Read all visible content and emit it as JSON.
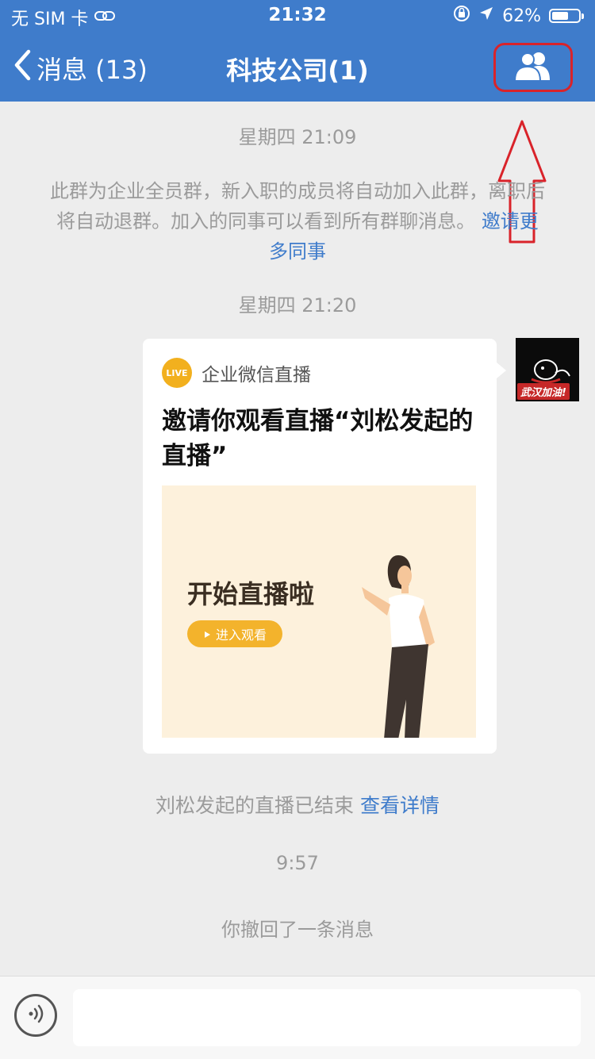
{
  "status": {
    "carrier": "无 SIM 卡",
    "time": "21:32",
    "battery": "62%",
    "battery_level": 0.62
  },
  "nav": {
    "back_label": "消息 (13)",
    "title": "科技公司(1)"
  },
  "messages": {
    "ts1": "星期四 21:09",
    "system_notice": "此群为企业全员群，新入职的成员将自动加入此群，离职后将自动退群。加入的同事可以看到所有群聊消息。",
    "invite_link": "邀请更多同事",
    "ts2": "星期四 21:20",
    "avatar_tag": "武汉加油!",
    "card": {
      "source": "企业微信直播",
      "badge": "LIVE",
      "title": "邀请你观看直播“刘松发起的直播”",
      "banner_heading": "开始直播啦",
      "banner_button": "进入观看"
    },
    "ended_text": "刘松发起的直播已结束",
    "details_link": "查看详情",
    "ts3": "9:57",
    "recall_text": "你撤回了一条消息"
  },
  "colors": {
    "header": "#3f7ccb",
    "annotation": "#d9232a",
    "link": "#3f7ccb"
  }
}
